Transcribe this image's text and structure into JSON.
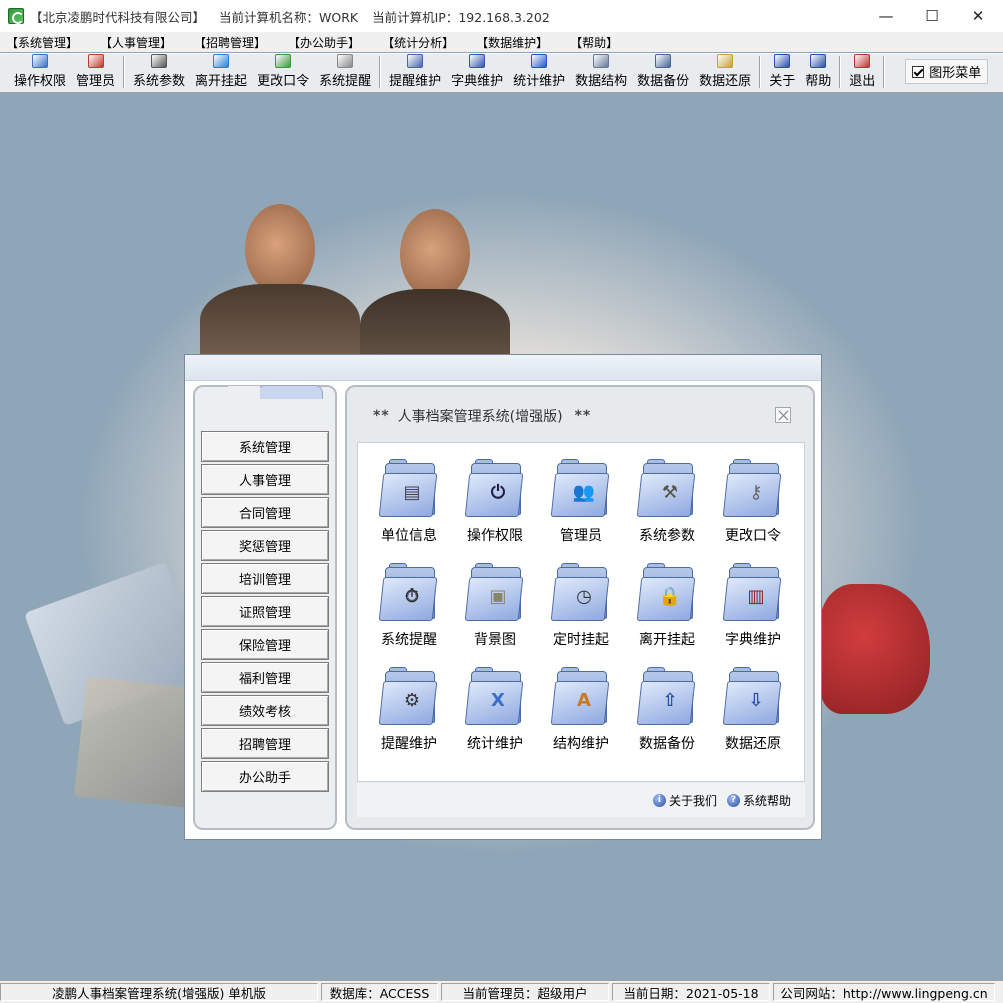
{
  "titlebar": {
    "company": "【北京凌鹏时代科技有限公司】",
    "computer_name": "当前计算机名称：WORK",
    "computer_ip": "当前计算机IP：192.168.3.202",
    "minimize": "—",
    "maximize": "☐",
    "close": "✕"
  },
  "menu": [
    "【系统管理】",
    "【人事管理】",
    "【招聘管理】",
    "【办公助手】",
    "【统计分析】",
    "【数据维护】",
    "【帮助】"
  ],
  "toolbar": {
    "groups": [
      [
        {
          "label": "操作权限",
          "icon": "permission-icon",
          "color": "#3a6fc8"
        },
        {
          "label": "管理员",
          "icon": "admin-icon",
          "color": "#c0392b"
        }
      ],
      [
        {
          "label": "系统参数",
          "icon": "parameters-icon",
          "color": "#555"
        },
        {
          "label": "离开挂起",
          "icon": "suspend-icon",
          "color": "#2a7fd4"
        },
        {
          "label": "更改口令",
          "icon": "password-icon",
          "color": "#3a9a3a"
        },
        {
          "label": "系统提醒",
          "icon": "reminder-icon",
          "color": "#888"
        }
      ],
      [
        {
          "label": "提醒维护",
          "icon": "reminder-maint-icon",
          "color": "#4466aa"
        },
        {
          "label": "字典维护",
          "icon": "dictionary-icon",
          "color": "#3355aa"
        },
        {
          "label": "统计维护",
          "icon": "statistics-icon",
          "color": "#2255cc"
        },
        {
          "label": "数据结构",
          "icon": "data-structure-icon",
          "color": "#667799"
        },
        {
          "label": "数据备份",
          "icon": "backup-icon",
          "color": "#446699"
        },
        {
          "label": "数据还原",
          "icon": "restore-icon",
          "color": "#c8a030"
        }
      ],
      [
        {
          "label": "关于",
          "icon": "about-icon",
          "color": "#2a4ea8"
        },
        {
          "label": "帮助",
          "icon": "help-icon",
          "color": "#2a4ea8"
        }
      ],
      [
        {
          "label": "退出",
          "icon": "exit-icon",
          "color": "#c03030"
        }
      ]
    ],
    "checkbox_label": "图形菜单",
    "checkbox_checked": true
  },
  "dialog": {
    "title": "人事档案管理系统(增强版)",
    "stars": "**",
    "nav": [
      "系统管理",
      "人事管理",
      "合同管理",
      "奖惩管理",
      "培训管理",
      "证照管理",
      "保险管理",
      "福利管理",
      "绩效考核",
      "招聘管理",
      "办公助手"
    ],
    "grid": [
      {
        "label": "单位信息",
        "icon": "document-icon",
        "glyph": "▤",
        "color": "#445"
      },
      {
        "label": "操作权限",
        "icon": "power-icon",
        "glyph": "⏻",
        "color": "#224"
      },
      {
        "label": "管理员",
        "icon": "users-icon",
        "glyph": "👥",
        "color": "#3a8a3a"
      },
      {
        "label": "系统参数",
        "icon": "tools-icon",
        "glyph": "⚒",
        "color": "#554"
      },
      {
        "label": "更改口令",
        "icon": "keys-icon",
        "glyph": "⚷",
        "color": "#666"
      },
      {
        "label": "系统提醒",
        "icon": "stopwatch-icon",
        "glyph": "⏱",
        "color": "#333"
      },
      {
        "label": "背景图",
        "icon": "picture-icon",
        "glyph": "▣",
        "color": "#886"
      },
      {
        "label": "定时挂起",
        "icon": "clock-icon",
        "glyph": "◷",
        "color": "#333"
      },
      {
        "label": "离开挂起",
        "icon": "lock-icon",
        "glyph": "🔒",
        "color": "#777"
      },
      {
        "label": "字典维护",
        "icon": "books-icon",
        "glyph": "▥",
        "color": "#8a2222"
      },
      {
        "label": "提醒维护",
        "icon": "gear-icon",
        "glyph": "⚙",
        "color": "#333"
      },
      {
        "label": "统计维护",
        "icon": "x-icon",
        "glyph": "X",
        "color": "#3a6fc8"
      },
      {
        "label": "结构维护",
        "icon": "app-a-icon",
        "glyph": "A",
        "color": "#c87a20"
      },
      {
        "label": "数据备份",
        "icon": "arrow-up-icon",
        "glyph": "⇧",
        "color": "#2a4ea8"
      },
      {
        "label": "数据还原",
        "icon": "arrow-down-icon",
        "glyph": "⇩",
        "color": "#2a4ea8"
      }
    ],
    "about_link": "关于我们",
    "help_link": "系统帮助"
  },
  "statusbar": {
    "app": "凌鹏人事档案管理系统(增强版) 单机版",
    "database": "数据库：ACCESS",
    "admin": "当前管理员：超级用户",
    "date": "当前日期：2021-05-18",
    "website": "公司网站：http://www.lingpeng.cn"
  }
}
